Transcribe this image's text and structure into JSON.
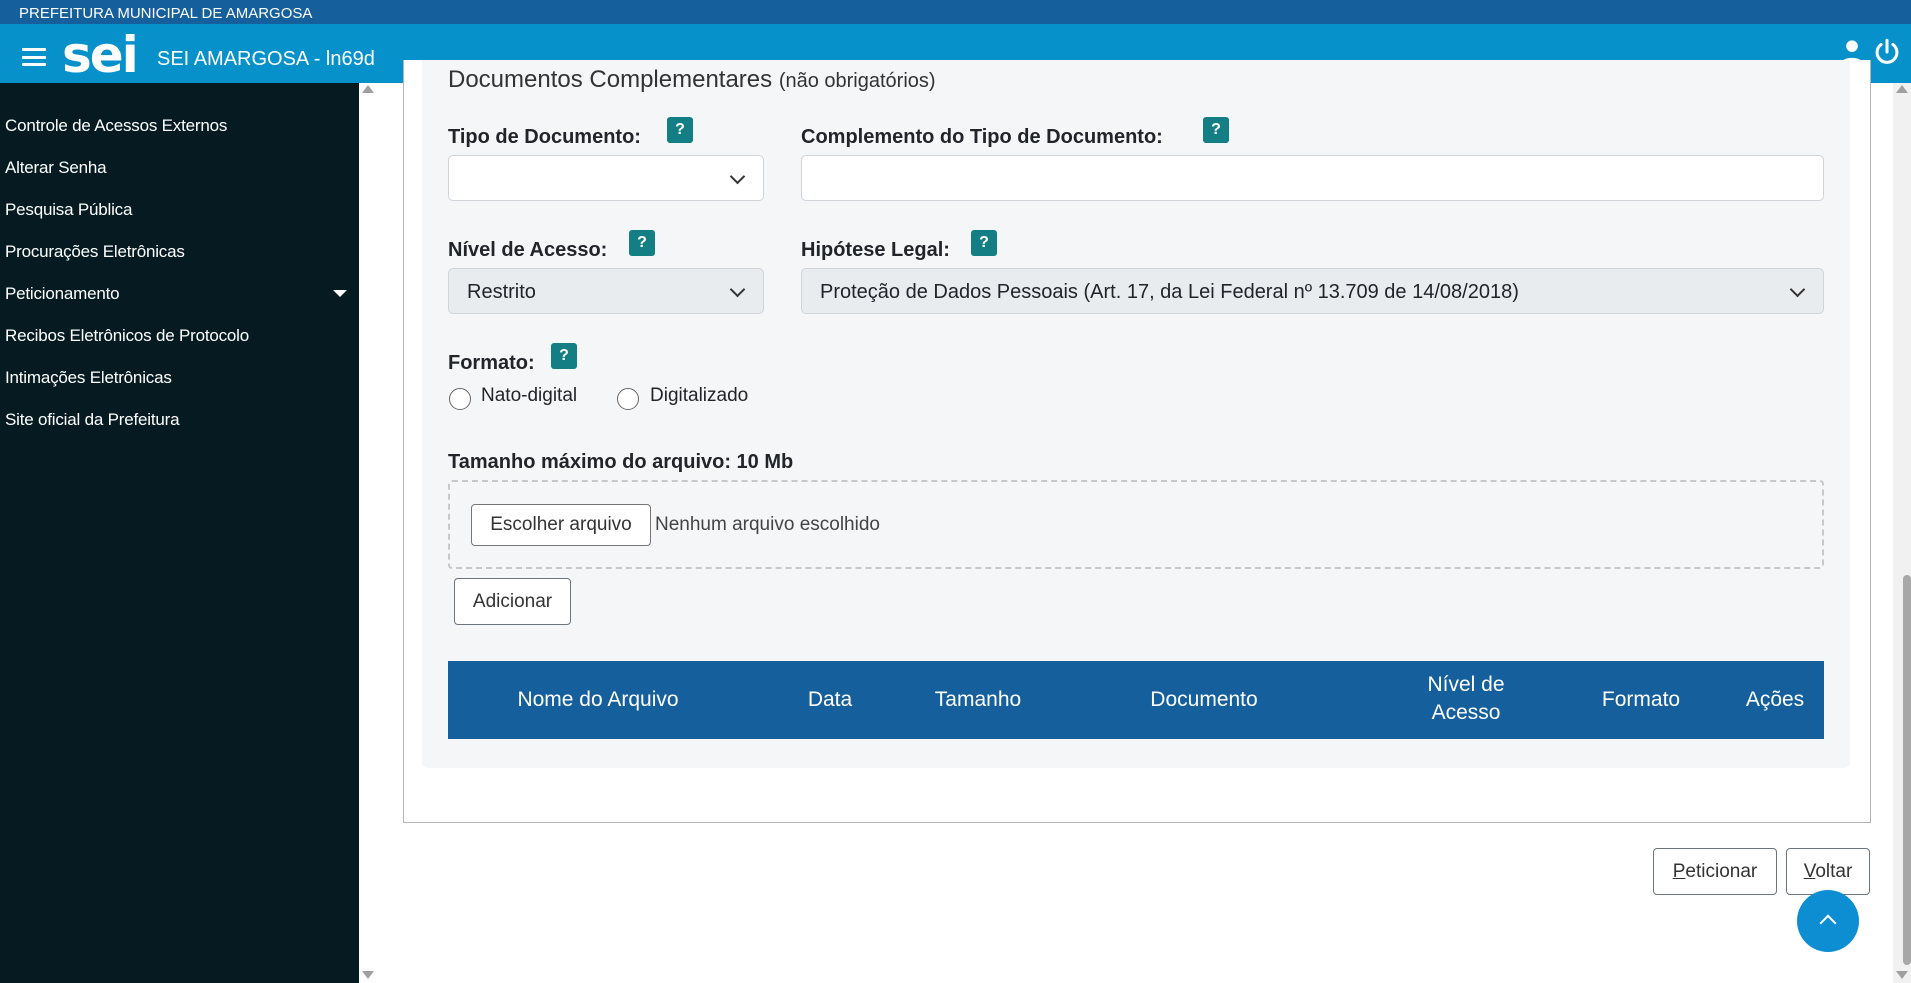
{
  "top_bar": {
    "text": "PREFEITURA MUNICIPAL DE AMARGOSA"
  },
  "header": {
    "logo": "sei",
    "title": "SEI AMARGOSA - ln69d",
    "icons": [
      "menu-icon",
      "user-icon",
      "power-icon"
    ]
  },
  "sidebar": {
    "items": [
      {
        "label": "Controle de Acessos Externos"
      },
      {
        "label": "Alterar Senha"
      },
      {
        "label": "Pesquisa Pública"
      },
      {
        "label": "Procurações Eletrônicas"
      },
      {
        "label": "Peticionamento",
        "has_submenu": true
      },
      {
        "label": "Recibos Eletrônicos de Protocolo"
      },
      {
        "label": "Intimações Eletrônicas"
      },
      {
        "label": "Site oficial da Prefeitura"
      }
    ]
  },
  "section": {
    "title": "Documentos Complementares",
    "subtitle": "(não obrigatórios)",
    "tipo_documento": {
      "label": "Tipo de Documento:",
      "value": "",
      "help": "?"
    },
    "complemento": {
      "label": "Complemento do Tipo de Documento:",
      "value": "",
      "help": "?"
    },
    "nivel_acesso": {
      "label": "Nível de Acesso:",
      "value": "Restrito",
      "help": "?"
    },
    "hipotese_legal": {
      "label": "Hipótese Legal:",
      "value": "Proteção de Dados Pessoais (Art. 17, da Lei Federal nº 13.709 de 14/08/2018)",
      "help": "?"
    },
    "formato": {
      "label": "Formato:",
      "help": "?",
      "options": [
        "Nato-digital",
        "Digitalizado"
      ],
      "selected": null
    },
    "max_size": "Tamanho máximo do arquivo: 10 Mb",
    "file_button": "Escolher arquivo",
    "file_status": "Nenhum arquivo escolhido",
    "add_button": "Adicionar",
    "table": {
      "columns": [
        "Nome do Arquivo",
        "Data",
        "Tamanho",
        "Documento",
        "Nível de Acesso",
        "Formato",
        "Ações"
      ],
      "column_lines": [
        [
          "Nome do Arquivo"
        ],
        [
          "Data"
        ],
        [
          "Tamanho"
        ],
        [
          "Documento"
        ],
        [
          "Nível de",
          "Acesso"
        ],
        [
          "Formato"
        ],
        [
          "Ações"
        ]
      ],
      "rows": []
    }
  },
  "footer": {
    "peticionar": {
      "accesskey": "P",
      "rest": "eticionar"
    },
    "voltar": {
      "accesskey": "V",
      "rest": "oltar"
    }
  }
}
